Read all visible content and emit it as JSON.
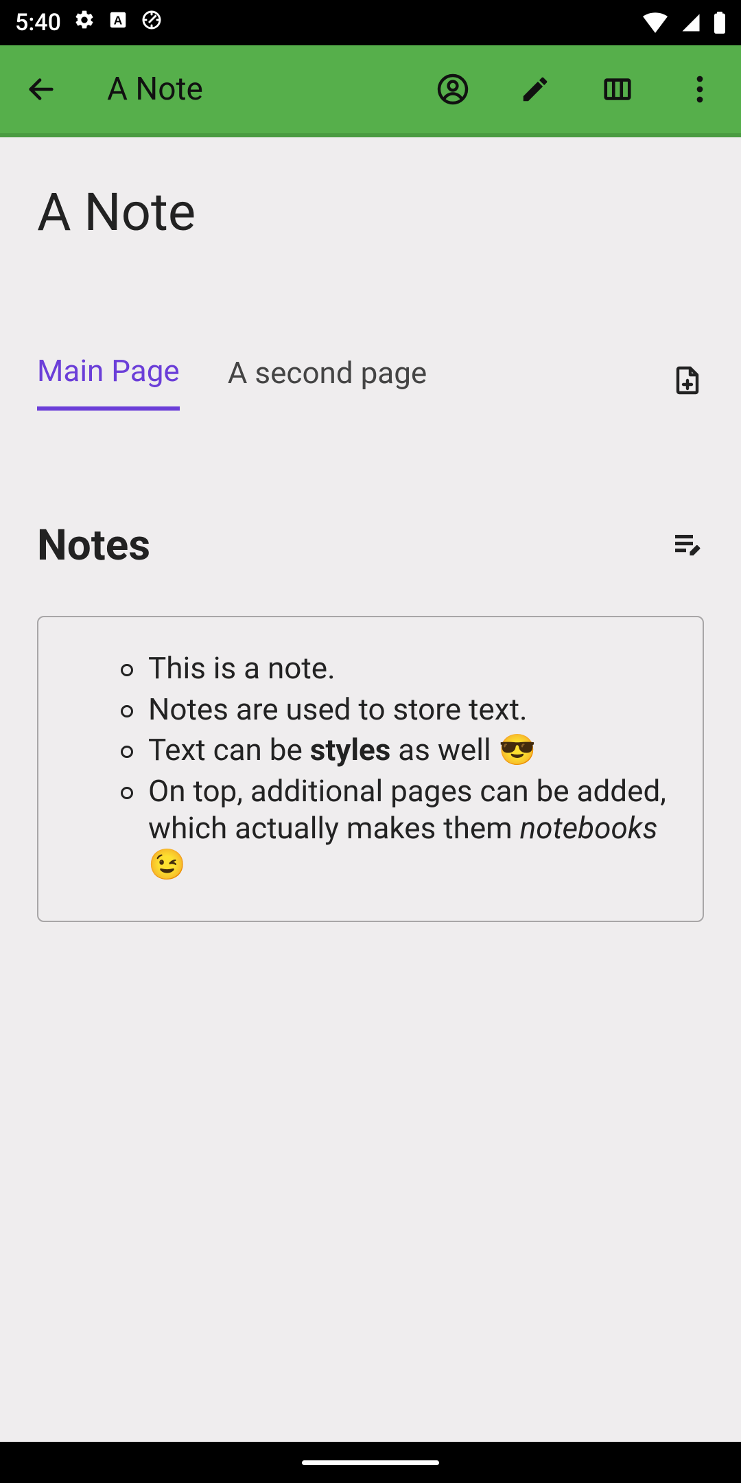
{
  "status": {
    "time": "5:40"
  },
  "appbar": {
    "title": "A Note"
  },
  "page": {
    "title": "A Note"
  },
  "tabs": [
    {
      "label": "Main Page",
      "active": true
    },
    {
      "label": "A second page",
      "active": false
    }
  ],
  "section": {
    "heading": "Notes"
  },
  "note": {
    "items": [
      {
        "html": "This is a note."
      },
      {
        "html": "Notes are used to store text."
      },
      {
        "html": "Text can be <b>styles</b> as well 😎"
      },
      {
        "html": "On top, additional pages can be added, which actually makes them <i>notebooks</i> 😉"
      }
    ]
  },
  "colors": {
    "appbar": "#56af4b",
    "accent": "#6b3ed8"
  }
}
